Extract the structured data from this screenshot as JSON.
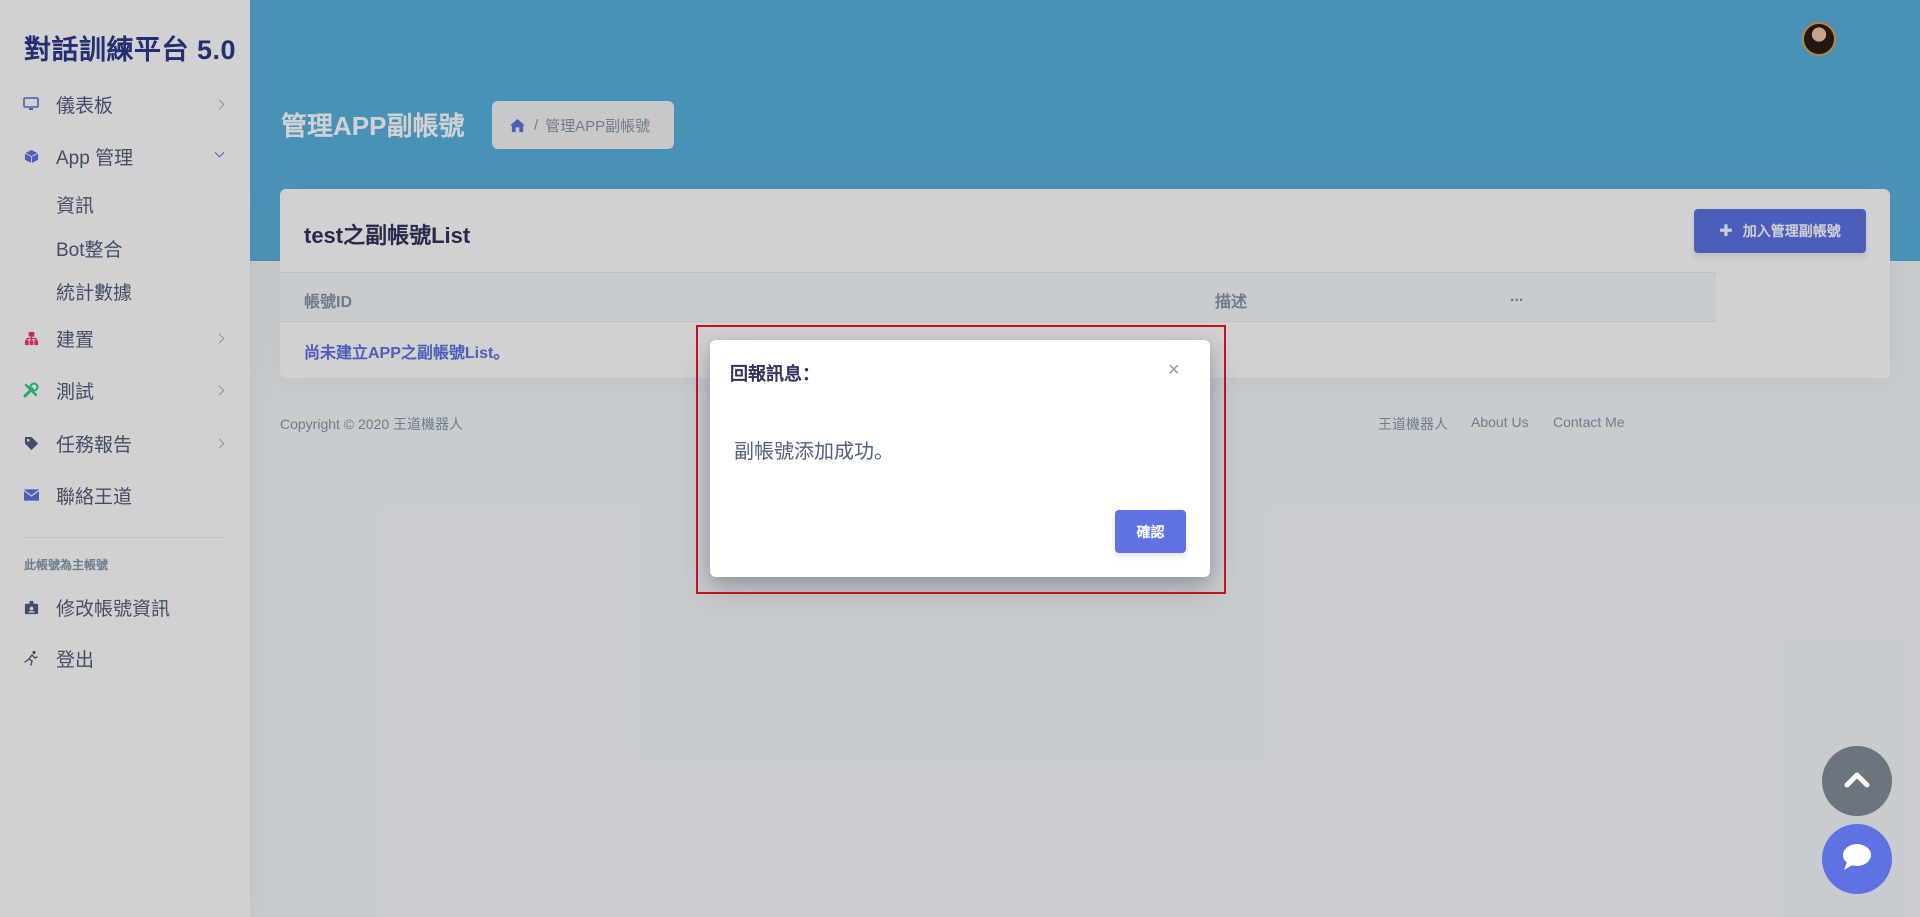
{
  "app": {
    "brand": "對話訓練平台 5.0"
  },
  "sidebar": {
    "items": [
      {
        "label": "儀表板",
        "icon": "monitor-icon",
        "color": "#5e72e4"
      },
      {
        "label": "App 管理",
        "icon": "cube-icon",
        "color": "#5e72e4"
      },
      {
        "label": "建置",
        "icon": "sitemap-icon",
        "color": "#f5365c"
      },
      {
        "label": "測試",
        "icon": "tools-icon",
        "color": "#2dce89"
      },
      {
        "label": "任務報告",
        "icon": "tag-icon",
        "color": "#525f7f"
      },
      {
        "label": "聯絡王道",
        "icon": "envelope-icon",
        "color": "#5e72e4"
      }
    ],
    "subitems": [
      "資訊",
      "Bot整合",
      "統計數據"
    ],
    "section_label": "此帳號為主帳號",
    "account_items": [
      {
        "label": "修改帳號資訊",
        "icon": "id-badge-icon"
      },
      {
        "label": "登出",
        "icon": "running-icon"
      }
    ]
  },
  "header": {
    "title": "管理APP副帳號",
    "breadcrumb": {
      "separator": "/",
      "current": "管理APP副帳號"
    }
  },
  "card": {
    "title": "test之副帳號List",
    "add_button": "加入管理副帳號",
    "columns": [
      "帳號ID",
      "描述",
      "..."
    ],
    "empty_message": "尚未建立APP之副帳號List。"
  },
  "footer": {
    "copyright": "Copyright © 2020 王道機器人",
    "links": [
      "王道機器人",
      "About Us",
      "Contact Me"
    ]
  },
  "modal": {
    "title": "回報訊息：",
    "close": "×",
    "message": "副帳號添加成功。",
    "confirm": "確認"
  },
  "colors": {
    "primary": "#5e72e4",
    "header": "#5ab3e0",
    "highlight": "#c0131a"
  }
}
